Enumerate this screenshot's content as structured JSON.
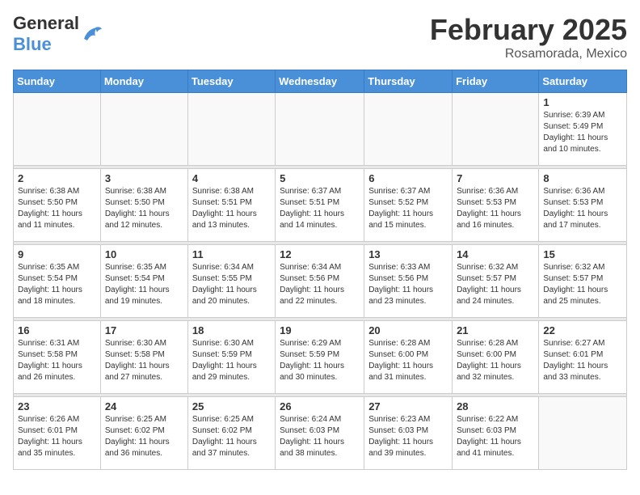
{
  "header": {
    "logo_general": "General",
    "logo_blue": "Blue",
    "month_title": "February 2025",
    "location": "Rosamorada, Mexico"
  },
  "weekdays": [
    "Sunday",
    "Monday",
    "Tuesday",
    "Wednesday",
    "Thursday",
    "Friday",
    "Saturday"
  ],
  "weeks": [
    [
      {
        "day": "",
        "info": ""
      },
      {
        "day": "",
        "info": ""
      },
      {
        "day": "",
        "info": ""
      },
      {
        "day": "",
        "info": ""
      },
      {
        "day": "",
        "info": ""
      },
      {
        "day": "",
        "info": ""
      },
      {
        "day": "1",
        "info": "Sunrise: 6:39 AM\nSunset: 5:49 PM\nDaylight: 11 hours and 10 minutes."
      }
    ],
    [
      {
        "day": "2",
        "info": "Sunrise: 6:38 AM\nSunset: 5:50 PM\nDaylight: 11 hours and 11 minutes."
      },
      {
        "day": "3",
        "info": "Sunrise: 6:38 AM\nSunset: 5:50 PM\nDaylight: 11 hours and 12 minutes."
      },
      {
        "day": "4",
        "info": "Sunrise: 6:38 AM\nSunset: 5:51 PM\nDaylight: 11 hours and 13 minutes."
      },
      {
        "day": "5",
        "info": "Sunrise: 6:37 AM\nSunset: 5:51 PM\nDaylight: 11 hours and 14 minutes."
      },
      {
        "day": "6",
        "info": "Sunrise: 6:37 AM\nSunset: 5:52 PM\nDaylight: 11 hours and 15 minutes."
      },
      {
        "day": "7",
        "info": "Sunrise: 6:36 AM\nSunset: 5:53 PM\nDaylight: 11 hours and 16 minutes."
      },
      {
        "day": "8",
        "info": "Sunrise: 6:36 AM\nSunset: 5:53 PM\nDaylight: 11 hours and 17 minutes."
      }
    ],
    [
      {
        "day": "9",
        "info": "Sunrise: 6:35 AM\nSunset: 5:54 PM\nDaylight: 11 hours and 18 minutes."
      },
      {
        "day": "10",
        "info": "Sunrise: 6:35 AM\nSunset: 5:54 PM\nDaylight: 11 hours and 19 minutes."
      },
      {
        "day": "11",
        "info": "Sunrise: 6:34 AM\nSunset: 5:55 PM\nDaylight: 11 hours and 20 minutes."
      },
      {
        "day": "12",
        "info": "Sunrise: 6:34 AM\nSunset: 5:56 PM\nDaylight: 11 hours and 22 minutes."
      },
      {
        "day": "13",
        "info": "Sunrise: 6:33 AM\nSunset: 5:56 PM\nDaylight: 11 hours and 23 minutes."
      },
      {
        "day": "14",
        "info": "Sunrise: 6:32 AM\nSunset: 5:57 PM\nDaylight: 11 hours and 24 minutes."
      },
      {
        "day": "15",
        "info": "Sunrise: 6:32 AM\nSunset: 5:57 PM\nDaylight: 11 hours and 25 minutes."
      }
    ],
    [
      {
        "day": "16",
        "info": "Sunrise: 6:31 AM\nSunset: 5:58 PM\nDaylight: 11 hours and 26 minutes."
      },
      {
        "day": "17",
        "info": "Sunrise: 6:30 AM\nSunset: 5:58 PM\nDaylight: 11 hours and 27 minutes."
      },
      {
        "day": "18",
        "info": "Sunrise: 6:30 AM\nSunset: 5:59 PM\nDaylight: 11 hours and 29 minutes."
      },
      {
        "day": "19",
        "info": "Sunrise: 6:29 AM\nSunset: 5:59 PM\nDaylight: 11 hours and 30 minutes."
      },
      {
        "day": "20",
        "info": "Sunrise: 6:28 AM\nSunset: 6:00 PM\nDaylight: 11 hours and 31 minutes."
      },
      {
        "day": "21",
        "info": "Sunrise: 6:28 AM\nSunset: 6:00 PM\nDaylight: 11 hours and 32 minutes."
      },
      {
        "day": "22",
        "info": "Sunrise: 6:27 AM\nSunset: 6:01 PM\nDaylight: 11 hours and 33 minutes."
      }
    ],
    [
      {
        "day": "23",
        "info": "Sunrise: 6:26 AM\nSunset: 6:01 PM\nDaylight: 11 hours and 35 minutes."
      },
      {
        "day": "24",
        "info": "Sunrise: 6:25 AM\nSunset: 6:02 PM\nDaylight: 11 hours and 36 minutes."
      },
      {
        "day": "25",
        "info": "Sunrise: 6:25 AM\nSunset: 6:02 PM\nDaylight: 11 hours and 37 minutes."
      },
      {
        "day": "26",
        "info": "Sunrise: 6:24 AM\nSunset: 6:03 PM\nDaylight: 11 hours and 38 minutes."
      },
      {
        "day": "27",
        "info": "Sunrise: 6:23 AM\nSunset: 6:03 PM\nDaylight: 11 hours and 39 minutes."
      },
      {
        "day": "28",
        "info": "Sunrise: 6:22 AM\nSunset: 6:03 PM\nDaylight: 11 hours and 41 minutes."
      },
      {
        "day": "",
        "info": ""
      }
    ]
  ]
}
